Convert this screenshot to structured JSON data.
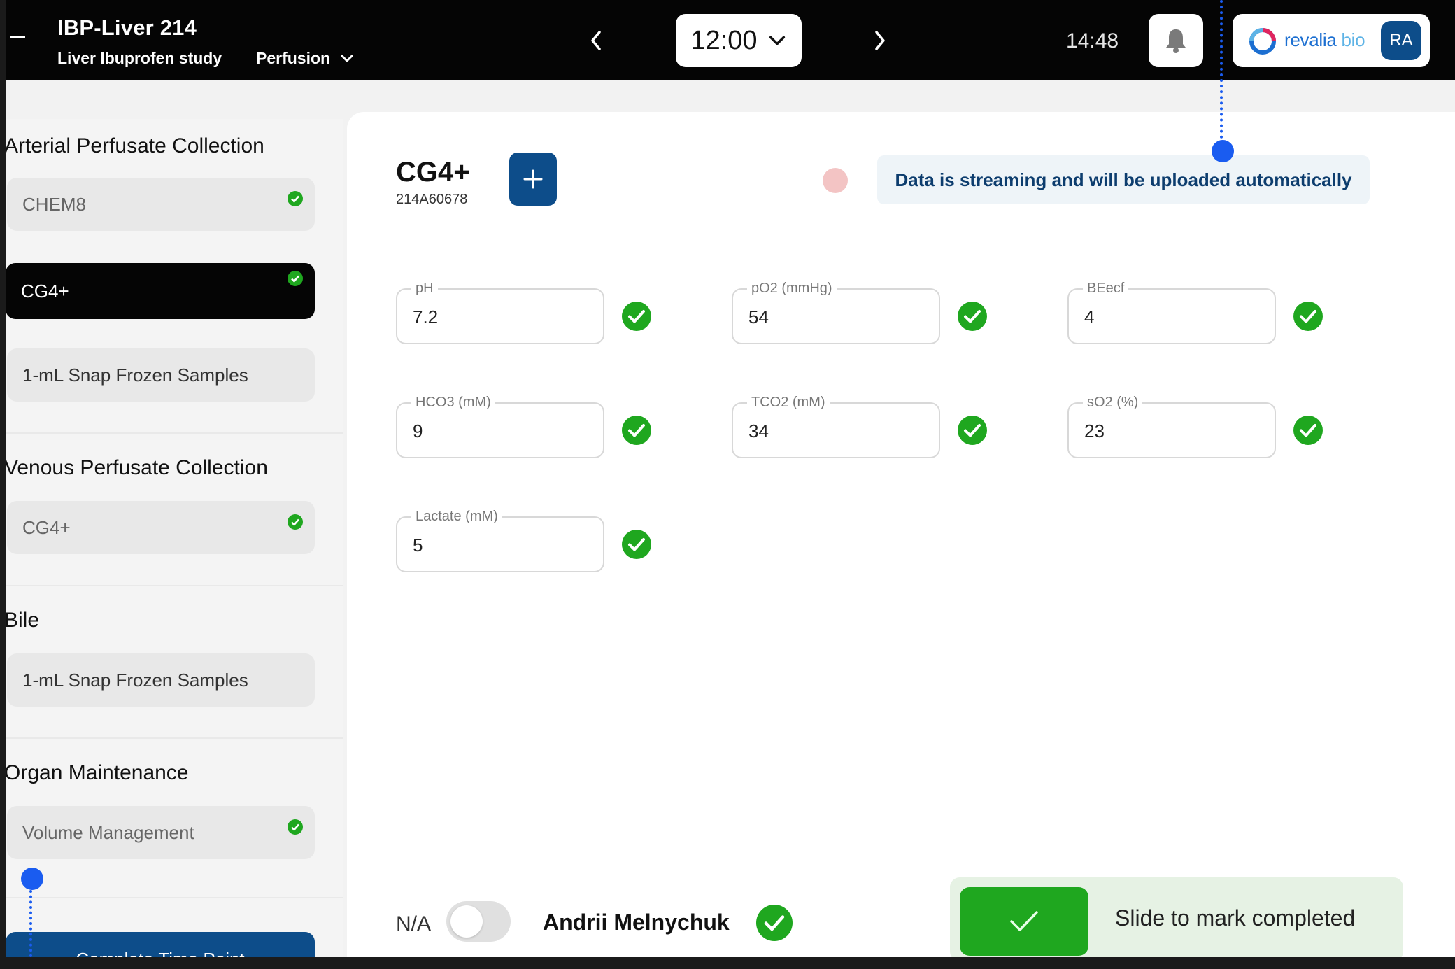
{
  "header": {
    "study_title": "IBP-Liver 214",
    "study_subtitle": "Liver Ibuprofen study",
    "phase": "Perfusion",
    "timepoint": "12:00",
    "clock": "14:48",
    "brand_name": "revalia",
    "brand_suffix": "bio",
    "avatar_initials": "RA"
  },
  "sidebar": {
    "groups": [
      {
        "title": "Arterial Perfusate Collection",
        "items": [
          {
            "label": "CHEM8",
            "checked": true
          },
          {
            "label": "CG4+",
            "checked": true,
            "active": true
          },
          {
            "label": "1-mL Snap Frozen Samples",
            "checked": false
          }
        ]
      },
      {
        "title": "Venous Perfusate Collection",
        "items": [
          {
            "label": "CG4+",
            "checked": true
          }
        ]
      },
      {
        "title": "Bile",
        "items": [
          {
            "label": "1-mL Snap Frozen Samples",
            "checked": false
          }
        ]
      },
      {
        "title": "Organ Maintenance",
        "items": [
          {
            "label": "Volume Management",
            "checked": true
          }
        ]
      }
    ],
    "complete_button": "Complete Time Point"
  },
  "main": {
    "device_title": "CG4+",
    "device_serial": "214A60678",
    "stream_message": "Data is streaming and will be uploaded automatically",
    "fields": [
      {
        "label": "pH",
        "value": "7.2"
      },
      {
        "label": "pO2 (mmHg)",
        "value": "54"
      },
      {
        "label": "BEecf",
        "value": "4"
      },
      {
        "label": "HCO3 (mM)",
        "value": "9"
      },
      {
        "label": "TCO2 (mM)",
        "value": "34"
      },
      {
        "label": "sO2 (%)",
        "value": "23"
      },
      {
        "label": "Lactate (mM)",
        "value": "5"
      }
    ],
    "na_label": "N/A",
    "na_toggle_on": false,
    "user_name": "Andrii Melnychuk",
    "slide_text": "Slide to mark completed"
  },
  "colors": {
    "brand_blue": "#0d4d8a",
    "success_green": "#1fa71f",
    "annotation_blue": "#1a5cf0",
    "header_black": "#050505"
  },
  "icons": {
    "back": "back-icon",
    "phase_dropdown": "chevron-down-icon",
    "prev": "chevron-left-icon",
    "next": "chevron-right-icon",
    "timepoint_dropdown": "chevron-down-icon",
    "notifications": "bell-icon",
    "add": "plus-icon",
    "check": "check-circle-icon"
  }
}
